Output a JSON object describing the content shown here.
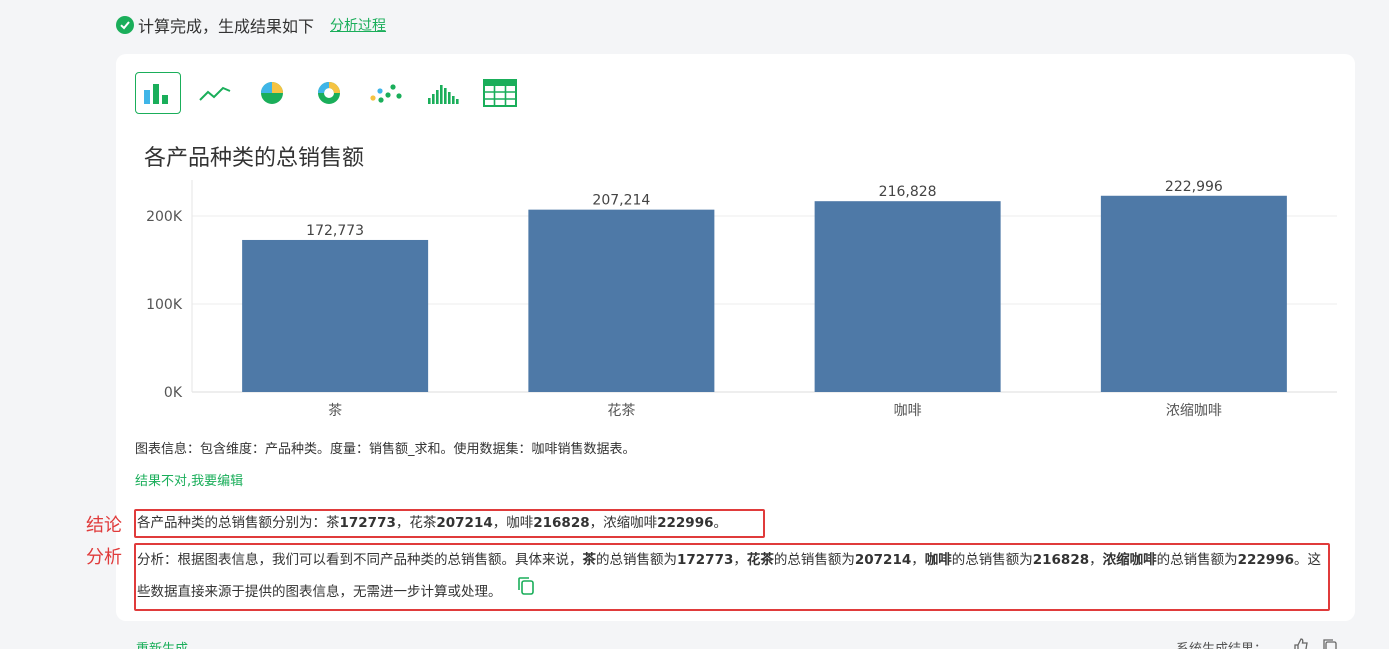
{
  "status": {
    "text": "计算完成，生成结果如下",
    "link": "分析过程"
  },
  "toolbar": {
    "items": [
      "bar-chart",
      "line-chart",
      "pie-chart",
      "donut-chart",
      "scatter-chart",
      "histogram-chart",
      "table-view"
    ],
    "active": "bar-chart"
  },
  "chart_data": {
    "type": "bar",
    "title": "各产品种类的总销售额",
    "categories": [
      "茶",
      "花茶",
      "咖啡",
      "浓缩咖啡"
    ],
    "values": [
      172773,
      207214,
      216828,
      222996
    ],
    "value_labels": [
      "172,773",
      "207,214",
      "216,828",
      "222,996"
    ],
    "y_ticks": [
      0,
      100000,
      200000
    ],
    "y_tick_labels": [
      "0K",
      "100K",
      "200K"
    ],
    "ylim": [
      0,
      250000
    ],
    "grid": true,
    "color": "#4e79a7"
  },
  "info": {
    "text": "图表信息：包含维度：产品种类。度量：销售额_求和。使用数据集：咖啡销售数据表。",
    "edit_link": "结果不对,我要编辑"
  },
  "conclusion": {
    "prefix": "各产品种类的总销售额分别为：",
    "parts": [
      {
        "name": "茶",
        "value": "172773",
        "sep": "，"
      },
      {
        "name": "花茶",
        "value": "207214",
        "sep": "，"
      },
      {
        "name": "咖啡",
        "value": "216828",
        "sep": "，"
      },
      {
        "name": "浓缩咖啡",
        "value": "222996",
        "sep": "。"
      }
    ]
  },
  "analysis": {
    "intro": "分析：根据图表信息，我们可以看到不同产品种类的总销售额。具体来说，",
    "mid": "的总销售额为",
    "seps": [
      "，",
      "，",
      "，",
      "。"
    ],
    "outro": "这些数据直接来源于提供的图表信息，无需进一步计算或处理。"
  },
  "side_labels": {
    "conclusion": "结论",
    "analysis": "分析"
  },
  "footer": {
    "regenerate": "重新生成",
    "system_result": "系统生成结果："
  },
  "colors": {
    "accent": "#1aae5a",
    "highlight_border": "#e03b3b",
    "bar": "#4e79a7"
  }
}
